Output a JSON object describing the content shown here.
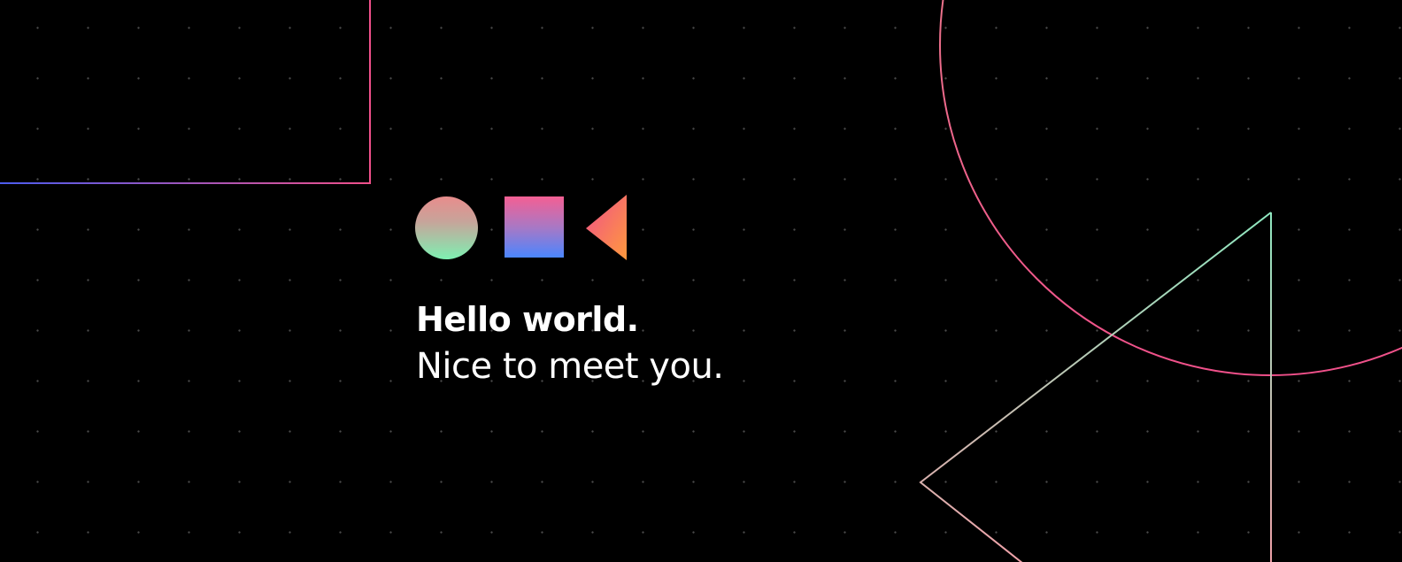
{
  "banner": {
    "headline": "Hello world.",
    "subline": "Nice to meet you.",
    "background_color": "#000000",
    "dot_color": "#7a7a7a",
    "text_color": "#ffffff"
  },
  "icons": [
    {
      "name": "circle-icon",
      "colors": [
        "#e88c8c",
        "#7ef0b2"
      ]
    },
    {
      "name": "square-icon",
      "colors": [
        "#f45f93",
        "#4a86ff"
      ]
    },
    {
      "name": "triangle-icon",
      "colors": [
        "#f0508a",
        "#ff9a3c"
      ]
    }
  ],
  "decorations": [
    {
      "name": "rectangle-outline-icon",
      "colors": [
        "#4a5cf0",
        "#f0508a"
      ]
    },
    {
      "name": "circle-outline-icon",
      "colors": [
        "#e88c8c",
        "#f0508a"
      ]
    },
    {
      "name": "triangle-outline-icon",
      "colors": [
        "#8fe8c0",
        "#f0a0a8"
      ]
    }
  ]
}
